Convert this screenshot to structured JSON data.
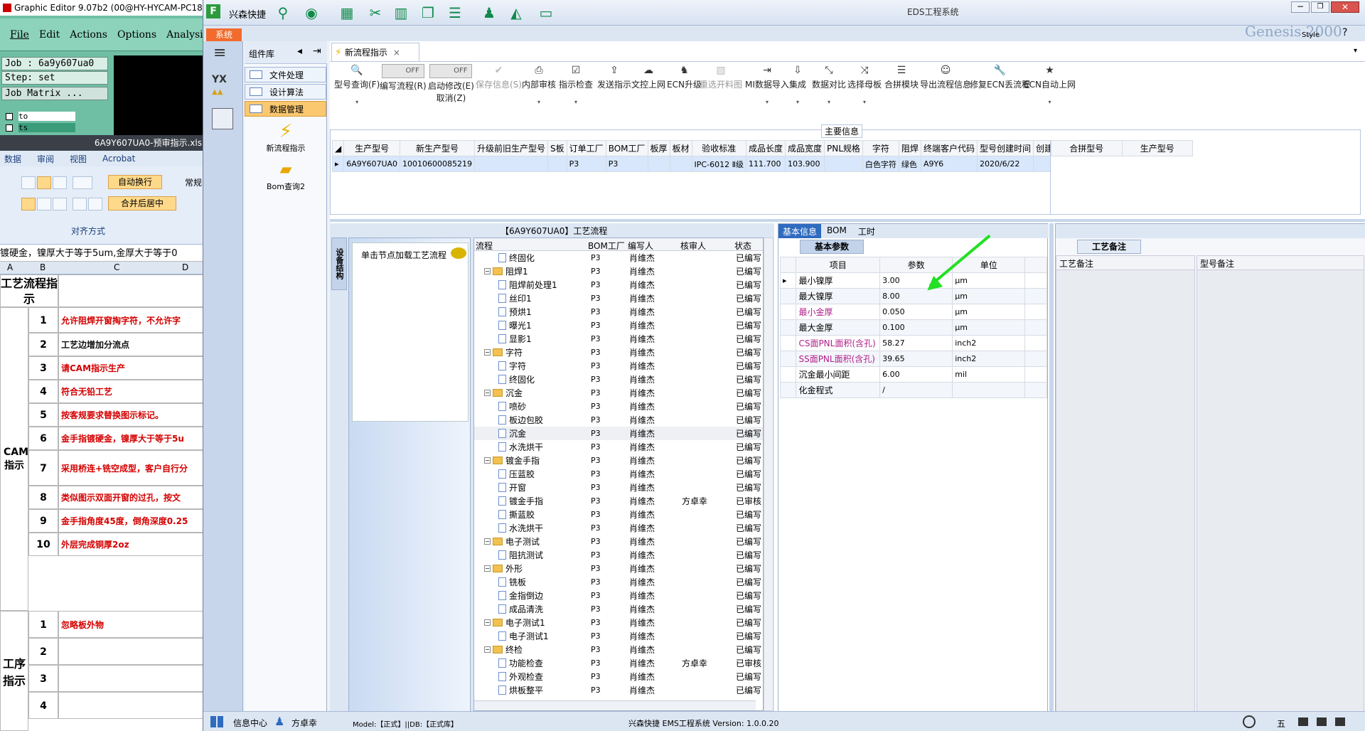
{
  "graphic_editor": {
    "title": "Graphic Editor 9.07b2 (00@HY-HYCAM-PC18",
    "menu": [
      "File",
      "Edit",
      "Actions",
      "Options",
      "Analysis"
    ],
    "job": "Job : 6a9y607ua0",
    "step": "Step: set",
    "job_matrix": "Job Matrix ...",
    "layers": [
      "to",
      "ts"
    ]
  },
  "excel": {
    "title": "6A9Y607UA0-预审指示.xls",
    "ribbon_tabs": [
      "数据",
      "审阅",
      "视图",
      "Acrobat"
    ],
    "auto_wrap": "自动换行",
    "merge_center": "合并后居中",
    "alignment_group": "对齐方式",
    "normal": "常规",
    "formula_text": "镀硬金，镍厚大于等于5um,金厚大于等于0",
    "cols": [
      "A",
      "B",
      "C",
      "D"
    ],
    "header_cell": "工艺流程指示",
    "cam_label": "CAM指示",
    "cam_rows": [
      {
        "n": "1",
        "text": "允许阻焊开窗掏字符，不允许字",
        "red": true
      },
      {
        "n": "2",
        "text": "工艺边增加分流点",
        "red": false
      },
      {
        "n": "3",
        "text": "请CAM指示生产",
        "red": true
      },
      {
        "n": "4",
        "text": "符合无铅工艺",
        "red": true
      },
      {
        "n": "5",
        "text": "按客规要求替换图示标记。",
        "red": true
      },
      {
        "n": "6",
        "text": "金手指镀硬金，镍厚大于等于5u",
        "red": true
      },
      {
        "n": "7",
        "text": "采用桥连+铣空成型，客户自行分",
        "red": true
      },
      {
        "n": "8",
        "text": "类似图示双面开窗的过孔，按文",
        "red": true
      },
      {
        "n": "9",
        "text": "金手指角度45度，倒角深度0.25",
        "red": true
      },
      {
        "n": "10",
        "text": "外层完成铜厚2oz",
        "red": true
      }
    ],
    "proc_label": "工序指示",
    "proc_rows": [
      {
        "n": "1",
        "text": "忽略板外物"
      },
      {
        "n": "2",
        "text": ""
      },
      {
        "n": "3",
        "text": ""
      },
      {
        "n": "4",
        "text": ""
      }
    ]
  },
  "eds": {
    "title": "EDS工程系统",
    "app_name": "兴森快捷",
    "system_tab": "系统",
    "ghost_text": "Genesis 2000",
    "style_label": "Style",
    "component_lib": "组件库",
    "sidebar_items": [
      "文件处理",
      "设计算法",
      "数据管理"
    ],
    "sidebar_tools": [
      "新流程指示",
      "Bom查询2"
    ],
    "doc_tab": "新流程指示",
    "toolbar": [
      {
        "label": "型号查询(F)",
        "glyph": "🔍",
        "dd": true,
        "disabled": false
      },
      {
        "label": "编写流程(R)",
        "glyph": "OFF",
        "toggle": true,
        "disabled": false
      },
      {
        "label": "启动修改(E)",
        "sub": "取消(Z)",
        "glyph": "OFF",
        "toggle": true,
        "disabled": false
      },
      {
        "label": "保存信息(S)",
        "glyph": "✔",
        "disabled": true
      },
      {
        "label": "内部审核",
        "glyph": "⎙",
        "dd": true,
        "disabled": false
      },
      {
        "label": "指示检查",
        "glyph": "☑",
        "dd": true,
        "disabled": false
      },
      {
        "label": "发送指示",
        "glyph": "⇪",
        "disabled": false
      },
      {
        "label": "文控上网",
        "glyph": "☁",
        "disabled": false
      },
      {
        "label": "ECN升级",
        "glyph": "♞",
        "disabled": false
      },
      {
        "label": "重选开料图",
        "glyph": "▧",
        "disabled": true
      },
      {
        "label": "MI数据导入",
        "glyph": "⇥",
        "dd": true,
        "disabled": false
      },
      {
        "label": "集成",
        "glyph": "⇩",
        "dd": true,
        "disabled": false
      },
      {
        "label": "数据对比",
        "glyph": "⤡",
        "dd": true,
        "disabled": false
      },
      {
        "label": "选择母板",
        "glyph": "⤨",
        "dd": true,
        "disabled": false
      },
      {
        "label": "合拼模块",
        "glyph": "☰",
        "disabled": false
      },
      {
        "label": "导出流程信息",
        "glyph": "☺",
        "disabled": false
      },
      {
        "label": "修复ECN丢流程",
        "glyph": "🔧",
        "disabled": false
      },
      {
        "label": "ECN自动上网",
        "glyph": "★",
        "dd": true,
        "disabled": false
      }
    ],
    "main_info_label": "主要信息",
    "main_cols": [
      "生产型号",
      "新生产型号",
      "升级前旧生产型号",
      "S板",
      "订单工厂",
      "BOM工厂",
      "板厚",
      "板材",
      "验收标准",
      "成品长度",
      "成品宽度",
      "PNL规格",
      "字符",
      "阻焊",
      "终端客户代码",
      "型号创建时间",
      "创建人"
    ],
    "main_row": [
      "6A9Y607UA0",
      "10010600085219",
      "",
      "",
      "P3",
      "P3",
      "",
      "",
      "IPC-6012 Ⅱ级",
      "111.700",
      "103.900",
      "",
      "白色字符",
      "绿色",
      "A9Y6",
      "2020/6/22",
      ""
    ],
    "merge_cols": [
      "合拼型号",
      "生产型号"
    ],
    "process_title": "【6A9Y607UA0】工艺流程",
    "equip_label": "设备结构",
    "load_node": "单击节点加载工艺流程",
    "tree_cols": [
      "流程",
      "BOM工厂",
      "编写人",
      "核审人",
      "状态"
    ],
    "tree": [
      {
        "d": 2,
        "t": "终固化",
        "f": false,
        "b": "P3",
        "w": "肖维杰",
        "r": "",
        "s": "已编写"
      },
      {
        "d": 1,
        "t": "阻焊1",
        "f": true,
        "b": "P3",
        "w": "肖维杰",
        "r": "",
        "s": "已编写"
      },
      {
        "d": 2,
        "t": "阻焊前处理1",
        "f": false,
        "b": "P3",
        "w": "肖维杰",
        "r": "",
        "s": "已编写"
      },
      {
        "d": 2,
        "t": "丝印1",
        "f": false,
        "b": "P3",
        "w": "肖维杰",
        "r": "",
        "s": "已编写"
      },
      {
        "d": 2,
        "t": "预烘1",
        "f": false,
        "b": "P3",
        "w": "肖维杰",
        "r": "",
        "s": "已编写"
      },
      {
        "d": 2,
        "t": "曝光1",
        "f": false,
        "b": "P3",
        "w": "肖维杰",
        "r": "",
        "s": "已编写"
      },
      {
        "d": 2,
        "t": "显影1",
        "f": false,
        "b": "P3",
        "w": "肖维杰",
        "r": "",
        "s": "已编写"
      },
      {
        "d": 1,
        "t": "字符",
        "f": true,
        "b": "P3",
        "w": "肖维杰",
        "r": "",
        "s": "已编写"
      },
      {
        "d": 2,
        "t": "字符",
        "f": false,
        "b": "P3",
        "w": "肖维杰",
        "r": "",
        "s": "已编写"
      },
      {
        "d": 2,
        "t": "终固化",
        "f": false,
        "b": "P3",
        "w": "肖维杰",
        "r": "",
        "s": "已编写"
      },
      {
        "d": 1,
        "t": "沉金",
        "f": true,
        "b": "P3",
        "w": "肖维杰",
        "r": "",
        "s": "已编写"
      },
      {
        "d": 2,
        "t": "喷砂",
        "f": false,
        "b": "P3",
        "w": "肖维杰",
        "r": "",
        "s": "已编写"
      },
      {
        "d": 2,
        "t": "板边包胶",
        "f": false,
        "b": "P3",
        "w": "肖维杰",
        "r": "",
        "s": "已编写"
      },
      {
        "d": 2,
        "t": "沉金",
        "f": false,
        "b": "P3",
        "w": "肖维杰",
        "r": "",
        "s": "已编写"
      },
      {
        "d": 2,
        "t": "水洗烘干",
        "f": false,
        "b": "P3",
        "w": "肖维杰",
        "r": "",
        "s": "已编写"
      },
      {
        "d": 1,
        "t": "镀金手指",
        "f": true,
        "b": "P3",
        "w": "肖维杰",
        "r": "",
        "s": "已编写"
      },
      {
        "d": 2,
        "t": "压蓝胶",
        "f": false,
        "b": "P3",
        "w": "肖维杰",
        "r": "",
        "s": "已编写"
      },
      {
        "d": 2,
        "t": "开窗",
        "f": false,
        "b": "P3",
        "w": "肖维杰",
        "r": "",
        "s": "已编写"
      },
      {
        "d": 2,
        "t": "镀金手指",
        "f": false,
        "b": "P3",
        "w": "肖维杰",
        "r": "方卓幸",
        "s": "已审核"
      },
      {
        "d": 2,
        "t": "撕蓝胶",
        "f": false,
        "b": "P3",
        "w": "肖维杰",
        "r": "",
        "s": "已编写"
      },
      {
        "d": 2,
        "t": "水洗烘干",
        "f": false,
        "b": "P3",
        "w": "肖维杰",
        "r": "",
        "s": "已编写"
      },
      {
        "d": 1,
        "t": "电子测试",
        "f": true,
        "b": "P3",
        "w": "肖维杰",
        "r": "",
        "s": "已编写"
      },
      {
        "d": 2,
        "t": "阻抗测试",
        "f": false,
        "b": "P3",
        "w": "肖维杰",
        "r": "",
        "s": "已编写"
      },
      {
        "d": 1,
        "t": "外形",
        "f": true,
        "b": "P3",
        "w": "肖维杰",
        "r": "",
        "s": "已编写"
      },
      {
        "d": 2,
        "t": "铣板",
        "f": false,
        "b": "P3",
        "w": "肖维杰",
        "r": "",
        "s": "已编写"
      },
      {
        "d": 2,
        "t": "金指倒边",
        "f": false,
        "b": "P3",
        "w": "肖维杰",
        "r": "",
        "s": "已编写"
      },
      {
        "d": 2,
        "t": "成品清洗",
        "f": false,
        "b": "P3",
        "w": "肖维杰",
        "r": "",
        "s": "已编写"
      },
      {
        "d": 1,
        "t": "电子测试1",
        "f": true,
        "b": "P3",
        "w": "肖维杰",
        "r": "",
        "s": "已编写"
      },
      {
        "d": 2,
        "t": "电子测试1",
        "f": false,
        "b": "P3",
        "w": "肖维杰",
        "r": "",
        "s": "已编写"
      },
      {
        "d": 1,
        "t": "终检",
        "f": true,
        "b": "P3",
        "w": "肖维杰",
        "r": "",
        "s": "已编写"
      },
      {
        "d": 2,
        "t": "功能检查",
        "f": false,
        "b": "P3",
        "w": "肖维杰",
        "r": "方卓幸",
        "s": "已审核"
      },
      {
        "d": 2,
        "t": "外观检查",
        "f": false,
        "b": "P3",
        "w": "肖维杰",
        "r": "",
        "s": "已编写"
      },
      {
        "d": 2,
        "t": "烘板整平",
        "f": false,
        "b": "P3",
        "w": "肖维杰",
        "r": "",
        "s": "已编写"
      }
    ],
    "info_tabs": [
      "基本信息",
      "BOM",
      "工时"
    ],
    "basic_params_tab": "基本参数",
    "param_cols": [
      "项目",
      "参数",
      "单位"
    ],
    "params": [
      {
        "k": "最小镍厚",
        "v": "3.00",
        "u": "μm",
        "hl": false
      },
      {
        "k": "最大镍厚",
        "v": "8.00",
        "u": "μm",
        "hl": false
      },
      {
        "k": "最小金厚",
        "v": "0.050",
        "u": "μm",
        "hl": true
      },
      {
        "k": "最大金厚",
        "v": "0.100",
        "u": "μm",
        "hl": false
      },
      {
        "k": "CS面PNL面积(含孔)",
        "v": "58.27",
        "u": "inch2",
        "hl": true
      },
      {
        "k": "SS面PNL面积(含孔)",
        "v": "39.65",
        "u": "inch2",
        "hl": true
      },
      {
        "k": "沉金最小间距",
        "v": "6.00",
        "u": "mil",
        "hl": false
      },
      {
        "k": "化金程式",
        "v": "/",
        "u": "",
        "hl": false
      }
    ],
    "process_notes_tab": "工艺备注",
    "process_notes_col": "工艺备注",
    "model_notes_col": "型号备注",
    "status": {
      "info_center": "信息中心",
      "user": "方卓幸",
      "model": "Model:【正式】||DB:【正式库】",
      "version": "兴森快捷 EMS工程系统 Version: 1.0.0.20"
    },
    "taskbar": {
      "ime": "五"
    }
  }
}
